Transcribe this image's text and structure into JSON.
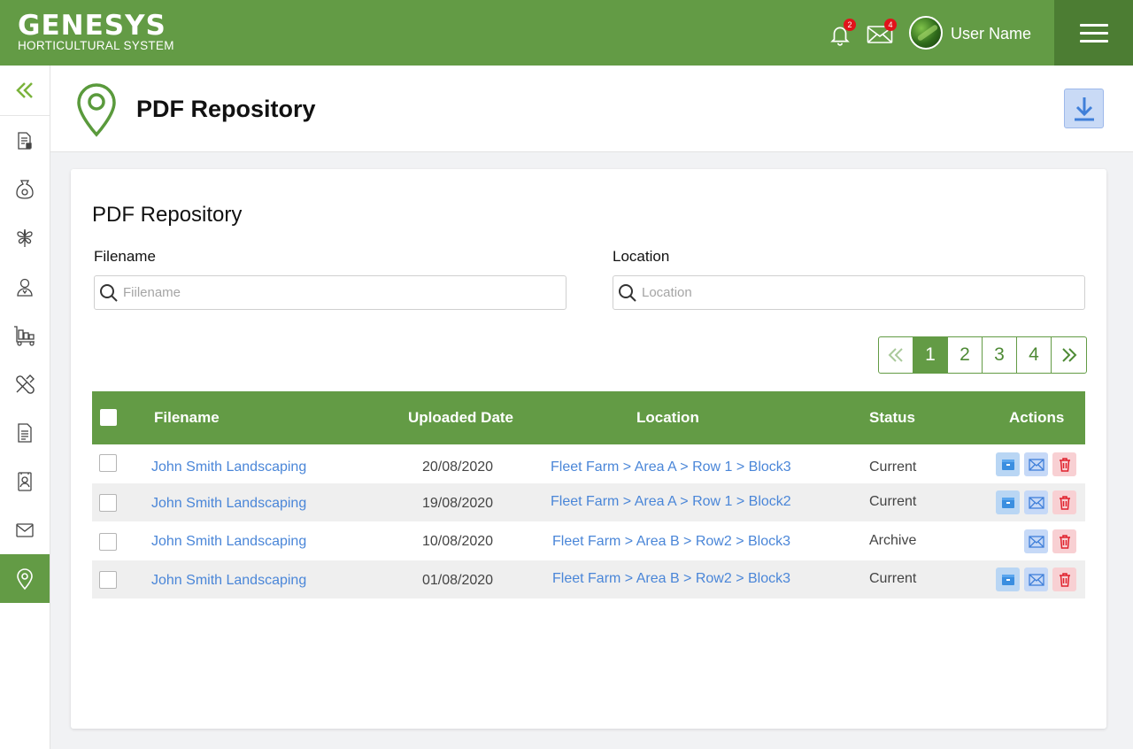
{
  "brand": {
    "name": "GENESYS",
    "tagline": "HORTICULTURAL SYSTEM"
  },
  "topbar": {
    "notifications_count": "2",
    "messages_count": "4",
    "user_name": "User Name"
  },
  "header": {
    "title": "PDF Repository"
  },
  "card": {
    "title": "PDF Repository",
    "filename_label": "Filename",
    "filename_placeholder": "Fiilename",
    "location_label": "Location",
    "location_placeholder": "Location"
  },
  "pagination": {
    "pages": [
      "1",
      "2",
      "3",
      "4"
    ],
    "current": "1"
  },
  "table": {
    "columns": {
      "filename": "Filename",
      "uploaded": "Uploaded Date",
      "location": "Location",
      "status": "Status",
      "actions": "Actions"
    },
    "rows": [
      {
        "filename": "John Smith Landscaping",
        "date": "20/08/2020",
        "location": "Fleet Farm > Area A > Row 1 > Block3",
        "status": "Current"
      },
      {
        "filename": "John Smith Landscaping",
        "date": "19/08/2020",
        "location": "Fleet Farm > Area A > Row 1 > Block2",
        "status": "Current"
      },
      {
        "filename": "John Smith Landscaping",
        "date": "10/08/2020",
        "location": "Fleet Farm > Area B > Row2 > Block3",
        "status": "Archive"
      },
      {
        "filename": "John Smith Landscaping",
        "date": "01/08/2020",
        "location": "Fleet Farm > Area B > Row2 > Block3",
        "status": "Current"
      }
    ]
  },
  "colors": {
    "primary": "#639b45",
    "primary_dark": "#4c7d33",
    "link": "#4a86d8",
    "badge": "#e1131b"
  },
  "sidebar_icons": [
    "report-icon",
    "seed-bag-icon",
    "plant-icon",
    "person-icon",
    "warehouse-trolley-icon",
    "tools-icon",
    "document-icon",
    "contact-book-icon",
    "mail-icon",
    "location-pin-icon"
  ]
}
